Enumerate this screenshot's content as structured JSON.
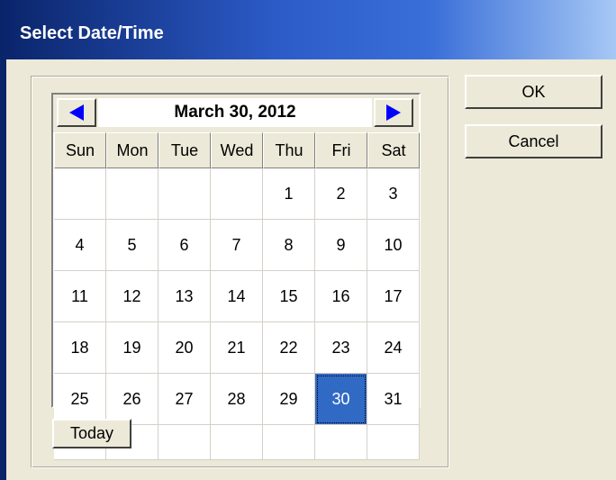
{
  "window": {
    "title": "Select Date/Time"
  },
  "calendar": {
    "month_label": "March 30, 2012",
    "weekdays": [
      "Sun",
      "Mon",
      "Tue",
      "Wed",
      "Thu",
      "Fri",
      "Sat"
    ],
    "days": [
      "",
      "",
      "",
      "",
      "1",
      "2",
      "3",
      "4",
      "5",
      "6",
      "7",
      "8",
      "9",
      "10",
      "11",
      "12",
      "13",
      "14",
      "15",
      "16",
      "17",
      "18",
      "19",
      "20",
      "21",
      "22",
      "23",
      "24",
      "25",
      "26",
      "27",
      "28",
      "29",
      "30",
      "31",
      "",
      "",
      "",
      "",
      "",
      "",
      ""
    ],
    "selected_day": "30",
    "prev_icon": "arrow-left-icon",
    "next_icon": "arrow-right-icon"
  },
  "buttons": {
    "ok": "OK",
    "cancel": "Cancel",
    "today": "Today"
  },
  "colors": {
    "accent": "#316ac5",
    "arrow": "#0000ff",
    "title_bar": "#0a246a"
  }
}
